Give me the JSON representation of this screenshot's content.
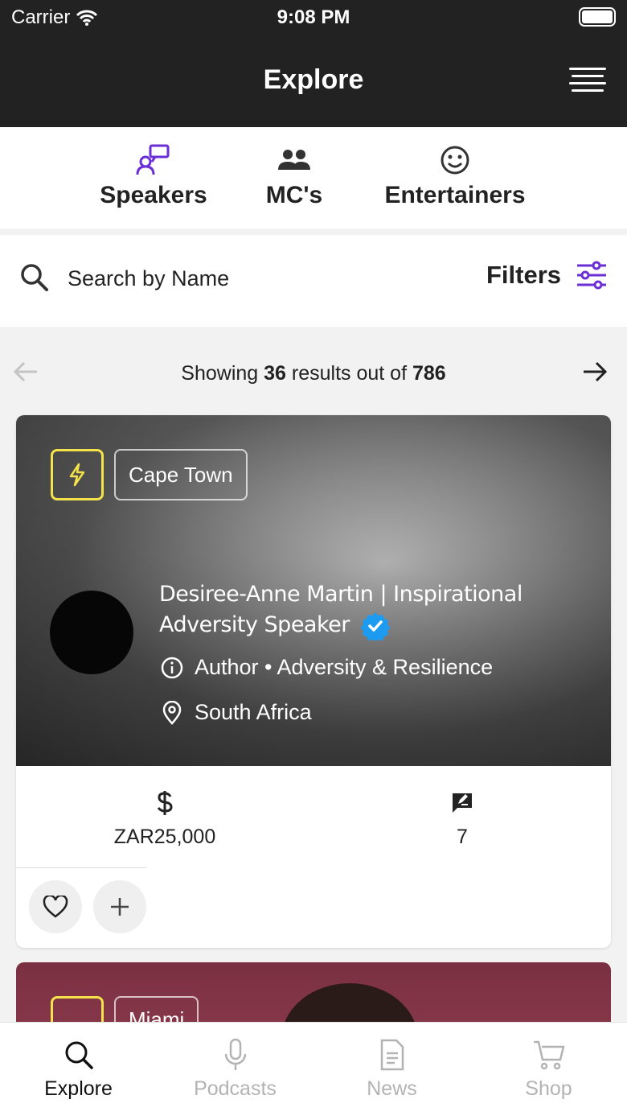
{
  "status_bar": {
    "carrier": "Carrier",
    "time": "9:08 PM"
  },
  "header": {
    "title": "Explore",
    "menu_icon": "menu-lines-icon"
  },
  "categories": [
    {
      "label": "Speakers",
      "icon": "speaker-presentation-icon",
      "active": true
    },
    {
      "label": "MC's",
      "icon": "people-group-icon",
      "active": false
    },
    {
      "label": "Entertainers",
      "icon": "smiley-face-icon",
      "active": false
    }
  ],
  "search": {
    "placeholder": "Search by Name",
    "filters_label": "Filters",
    "accent": "#6b2fd6"
  },
  "pagination": {
    "prefix": "Showing",
    "shown": "36",
    "middle": "results out of",
    "total": "786"
  },
  "cards": [
    {
      "city": "Cape Town",
      "name": "Desiree-Anne Martin | Inspirational Adversity Speaker",
      "verified": true,
      "topics": "Author • Adversity & Resilience",
      "country": "South Africa",
      "fee": "ZAR25,000",
      "reviews": "7",
      "bolt_color": "#f3e24a"
    },
    {
      "city": "Miami"
    }
  ],
  "tabs": [
    {
      "label": "Explore",
      "icon": "search-icon",
      "active": true
    },
    {
      "label": "Podcasts",
      "icon": "microphone-icon",
      "active": false
    },
    {
      "label": "News",
      "icon": "document-icon",
      "active": false
    },
    {
      "label": "Shop",
      "icon": "cart-icon",
      "active": false
    }
  ]
}
